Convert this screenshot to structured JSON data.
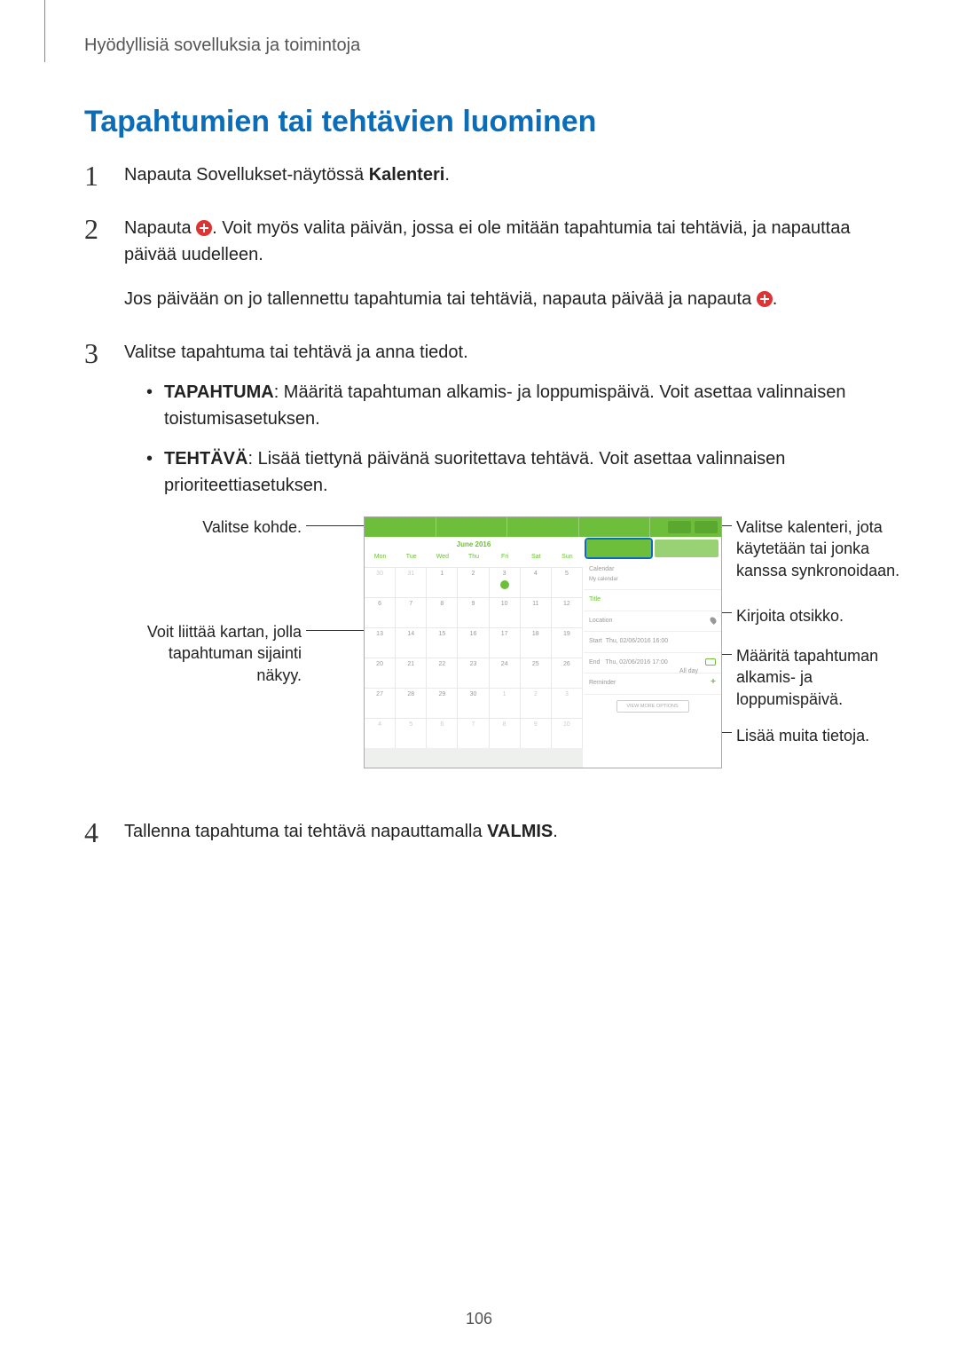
{
  "breadcrumb": "Hyödyllisiä sovelluksia ja toimintoja",
  "heading": "Tapahtumien tai tehtävien luominen",
  "steps": {
    "s1": {
      "num": "1",
      "text_before": "Napauta Sovellukset-näytössä ",
      "bold": "Kalenteri",
      "text_after": "."
    },
    "s2": {
      "num": "2",
      "text_before": "Napauta ",
      "text_after": ". Voit myös valita päivän, jossa ei ole mitään tapahtumia tai tehtäviä, ja napauttaa päivää uudelleen.",
      "para2_before": "Jos päivään on jo tallennettu tapahtumia tai tehtäviä, napauta päivää ja napauta ",
      "para2_after": "."
    },
    "s3": {
      "num": "3",
      "text": "Valitse tapahtuma tai tehtävä ja anna tiedot.",
      "bullet1_bold": "TAPAHTUMA",
      "bullet1_rest": ": Määritä tapahtuman alkamis- ja loppumispäivä. Voit asettaa valinnaisen toistumisasetuksen.",
      "bullet2_bold": "TEHTÄVÄ",
      "bullet2_rest": ": Lisää tiettynä päivänä suoritettava tehtävä. Voit asettaa valinnaisen prioriteettiasetuksen."
    },
    "s4": {
      "num": "4",
      "text_before": "Tallenna tapahtuma tai tehtävä napauttamalla ",
      "bold": "VALMIS",
      "text_after": "."
    }
  },
  "callouts": {
    "left1": "Valitse kohde.",
    "left2": "Voit liittää kartan, jolla tapahtuman sijainti näkyy.",
    "right1": "Valitse kalenteri, jota käytetään tai jonka kanssa synkronoidaan.",
    "right2": "Kirjoita otsikko.",
    "right3": "Määritä tapahtuman alkamis- ja loppumispäivä.",
    "right4": "Lisää muita tietoja."
  },
  "shot": {
    "month": "June 2016",
    "dow": [
      "Mon",
      "Tue",
      "Wed",
      "Thu",
      "Fri",
      "Sat",
      "Sun"
    ],
    "prev_month": [
      "30",
      "31"
    ],
    "days": [
      "1",
      "2",
      "3",
      "4",
      "5",
      "6",
      "7",
      "8",
      "9",
      "10",
      "11",
      "12",
      "13",
      "14",
      "15",
      "16",
      "17",
      "18",
      "19",
      "20",
      "21",
      "22",
      "23",
      "24",
      "25",
      "26",
      "27",
      "28",
      "29",
      "30"
    ],
    "next_month": [
      "1",
      "2",
      "3",
      "4",
      "5",
      "6",
      "7",
      "8",
      "9",
      "10"
    ],
    "today_index": 2,
    "calendar_label": "Calendar",
    "calendar_sub": "My calendar",
    "title_field": "Title",
    "location_field": "Location",
    "start_label": "Start",
    "start_value": "Thu, 02/06/2016   16:00",
    "end_label": "End",
    "end_value": "Thu, 02/06/2016   17:00",
    "allday_label": "All day",
    "reminder_label": "Reminder",
    "more_label": "VIEW MORE OPTIONS"
  },
  "page_number": "106"
}
